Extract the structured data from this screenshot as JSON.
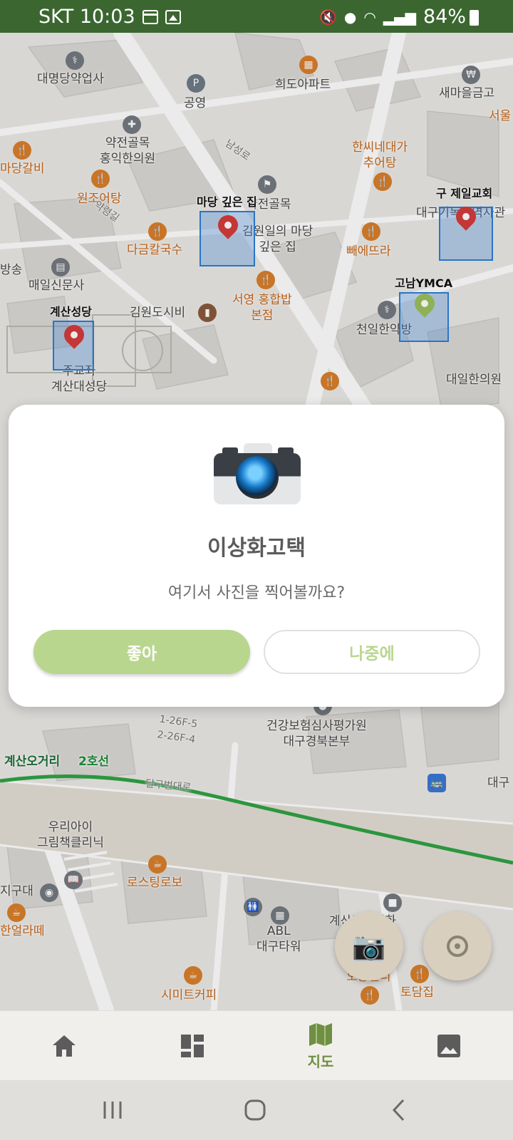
{
  "status_bar": {
    "carrier_time": "SKT 10:03",
    "battery": "84%",
    "icons": [
      "calendar-icon",
      "image-icon",
      "mute-icon",
      "location-icon",
      "wifi-icon",
      "signal-icon",
      "battery-icon"
    ]
  },
  "map": {
    "labels": [
      {
        "text": "대명당약업사"
      },
      {
        "text": "공영"
      },
      {
        "text": "희도아파트"
      },
      {
        "text": "새마을금고"
      },
      {
        "text": "서울"
      },
      {
        "text": "약전골목\n홍익한의원"
      },
      {
        "text": "마당갈비"
      },
      {
        "text": "원조어탕"
      },
      {
        "text": "한씨네대가\n추어탕"
      },
      {
        "text": "약전골목"
      },
      {
        "text": "다금칼국수"
      },
      {
        "text": "김원일의 마당\n깊은 집"
      },
      {
        "text": "빼에뜨라"
      },
      {
        "text": "대구기독교역사관"
      },
      {
        "text": "방송"
      },
      {
        "text": "매일신문사"
      },
      {
        "text": "서영 홍합밥\n본점"
      },
      {
        "text": "김원도시비"
      },
      {
        "text": "천일한약방"
      },
      {
        "text": "주교좌\n계산대성당"
      },
      {
        "text": "대일한의원"
      },
      {
        "text": "건강보험심사평가원\n대구경북본부"
      },
      {
        "text": "대구"
      },
      {
        "text": "우리아이\n그림책클리닉"
      },
      {
        "text": "로스팅로보"
      },
      {
        "text": "지구대"
      },
      {
        "text": "한얼라떼"
      },
      {
        "text": "ABL\n대구타워"
      },
      {
        "text": "계산일꽃백화"
      },
      {
        "text": "오송일리"
      },
      {
        "text": "토담집"
      },
      {
        "text": "시미트커피"
      },
      {
        "text": "남성로"
      },
      {
        "text": "약령길"
      },
      {
        "text": "달구벌대로"
      },
      {
        "text": "1-26F-5\n2-26F-4"
      }
    ],
    "spots": [
      {
        "title": "마당 깊은 집",
        "color": "red"
      },
      {
        "title": "구 제일교회",
        "color": "red"
      },
      {
        "title": "계산성당",
        "color": "red"
      },
      {
        "title": "고남YMCA",
        "color": "green"
      }
    ],
    "subway": {
      "station": "계산오거리",
      "line": "2호선"
    }
  },
  "dialog": {
    "icon": "camera-icon",
    "title": "이상화고택",
    "message": "여기서 사진을 찍어볼까요?",
    "confirm_label": "좋아",
    "later_label": "나중에"
  },
  "fabs": {
    "camera_icon": "camera-icon",
    "locate_icon": "my-location-icon"
  },
  "bottom_nav": {
    "items": [
      {
        "icon": "home-icon",
        "label": ""
      },
      {
        "icon": "dashboard-icon",
        "label": ""
      },
      {
        "icon": "map-icon",
        "label": "지도"
      },
      {
        "icon": "photo-icon",
        "label": ""
      }
    ],
    "active_color": "#6f8f44"
  },
  "system_nav": {
    "icons": [
      "recents-icon",
      "home-circle-icon",
      "back-icon"
    ]
  }
}
